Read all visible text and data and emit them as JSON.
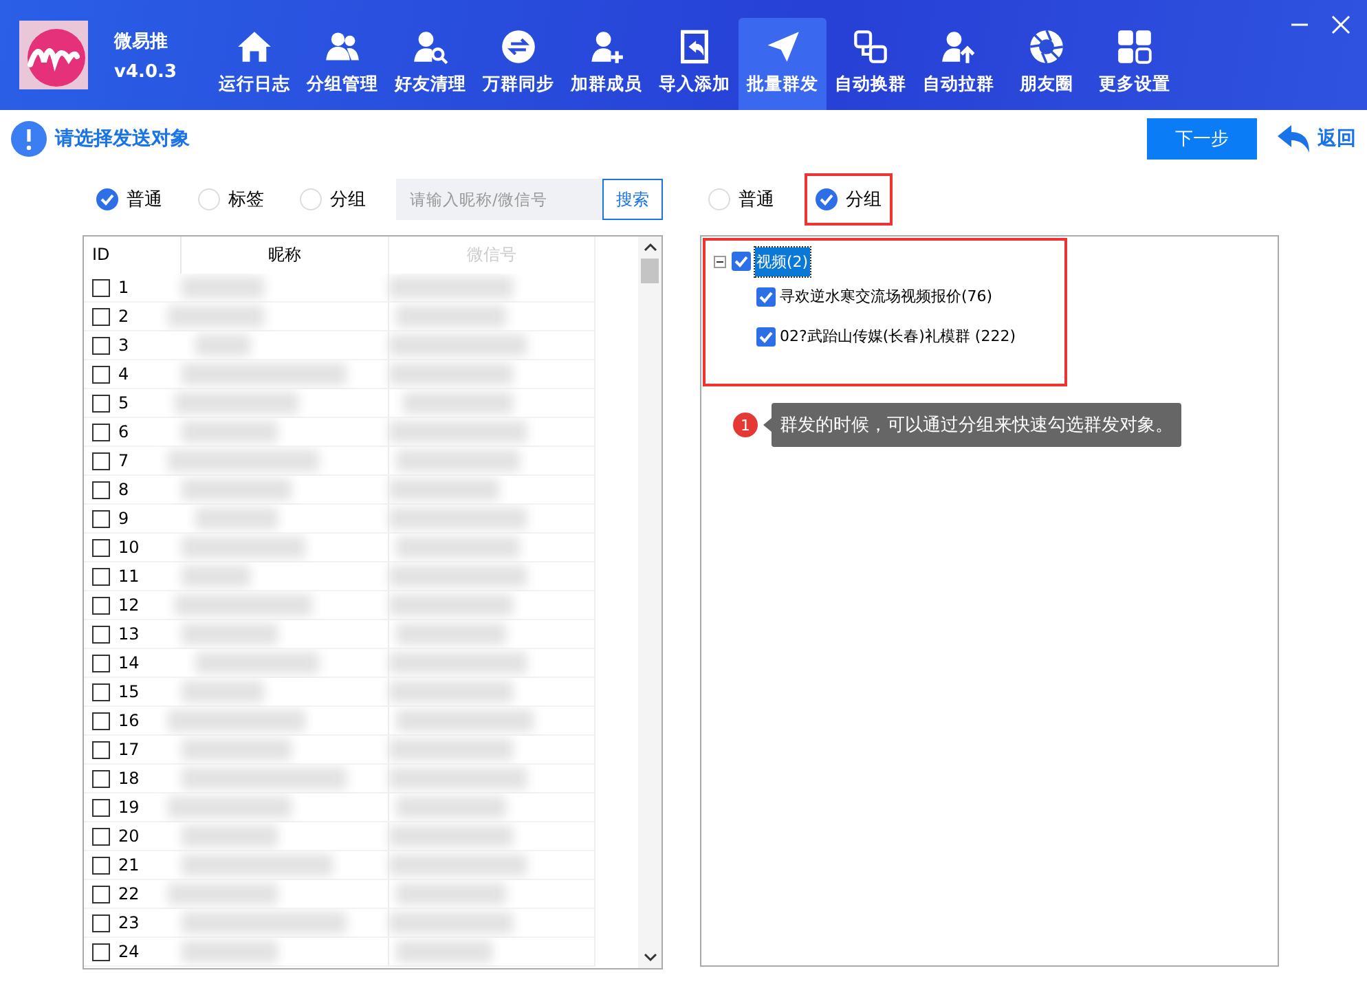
{
  "app": {
    "name": "微易推",
    "version": "v4.0.3"
  },
  "nav": [
    {
      "label": "运行日志",
      "selected": false
    },
    {
      "label": "分组管理",
      "selected": false
    },
    {
      "label": "好友清理",
      "selected": false
    },
    {
      "label": "万群同步",
      "selected": false
    },
    {
      "label": "加群成员",
      "selected": false
    },
    {
      "label": "导入添加",
      "selected": false
    },
    {
      "label": "批量群发",
      "selected": true
    },
    {
      "label": "自动换群",
      "selected": false
    },
    {
      "label": "自动拉群",
      "selected": false
    },
    {
      "label": "朋友圈",
      "selected": false
    },
    {
      "label": "更多设置",
      "selected": false
    }
  ],
  "header": {
    "title": "请选择发送对象",
    "next_button": "下一步",
    "back_link": "返回"
  },
  "left_filter": {
    "options": [
      {
        "label": "普通",
        "selected": true
      },
      {
        "label": "标签",
        "selected": false
      },
      {
        "label": "分组",
        "selected": false
      }
    ],
    "search": {
      "placeholder": "请输入昵称/微信号",
      "button": "搜索"
    }
  },
  "table": {
    "columns": [
      "ID",
      "昵称",
      "微信号"
    ],
    "rows": [
      {
        "number": "1",
        "checked": false
      },
      {
        "number": "2",
        "checked": false
      },
      {
        "number": "3",
        "checked": false
      },
      {
        "number": "4",
        "checked": false
      },
      {
        "number": "5",
        "checked": false
      },
      {
        "number": "6",
        "checked": false
      },
      {
        "number": "7",
        "checked": false
      },
      {
        "number": "8",
        "checked": false
      },
      {
        "number": "9",
        "checked": false
      },
      {
        "number": "10",
        "checked": false
      },
      {
        "number": "11",
        "checked": false
      },
      {
        "number": "12",
        "checked": false
      },
      {
        "number": "13",
        "checked": false
      },
      {
        "number": "14",
        "checked": false
      },
      {
        "number": "15",
        "checked": false
      },
      {
        "number": "16",
        "checked": false
      },
      {
        "number": "17",
        "checked": false
      },
      {
        "number": "18",
        "checked": false
      },
      {
        "number": "19",
        "checked": false
      },
      {
        "number": "20",
        "checked": false
      },
      {
        "number": "21",
        "checked": false
      },
      {
        "number": "22",
        "checked": false
      },
      {
        "number": "23",
        "checked": false
      },
      {
        "number": "24",
        "checked": false
      }
    ]
  },
  "right_filter": {
    "options": [
      {
        "label": "普通",
        "selected": false
      },
      {
        "label": "分组",
        "selected": true
      }
    ]
  },
  "tree": [
    {
      "label": "视频(2)",
      "checked": true,
      "expanded": true,
      "selected": true,
      "children": [
        {
          "label": "寻欢逆水寒交流场视频报价(76)",
          "checked": true,
          "selected": false
        },
        {
          "label": "02?武跆山传媒(长春)礼模群 (222)",
          "checked": true,
          "selected": false
        }
      ]
    }
  ],
  "callout": {
    "number": "1",
    "text": "群发的时候，可以通过分组来快速勾选群发对象。"
  }
}
